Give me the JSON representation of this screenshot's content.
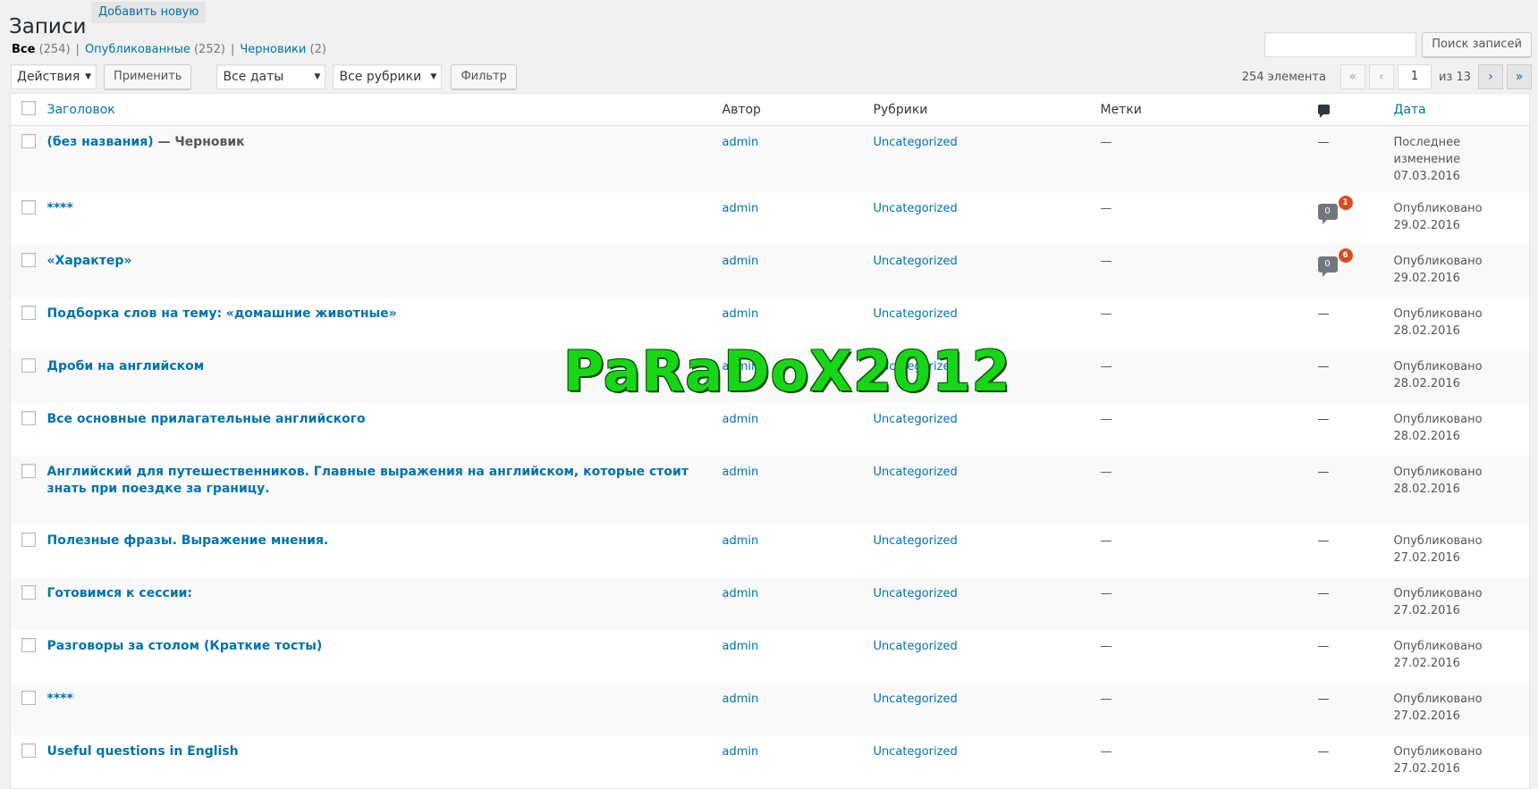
{
  "page": {
    "title": "Записи",
    "add_new": "Добавить новую"
  },
  "views": [
    {
      "label": "Все",
      "count": "(254)",
      "current": true
    },
    {
      "label": "Опубликованные",
      "count": "(252)",
      "current": false
    },
    {
      "label": "Черновики",
      "count": "(2)",
      "current": false
    }
  ],
  "search": {
    "value": "",
    "button": "Поиск записей"
  },
  "tablenav": {
    "bulk_action": "Действия",
    "apply": "Применить",
    "date_filter": "Все даты",
    "category_filter": "Все рубрики",
    "filter": "Фильтр",
    "displaying": "254 элемента",
    "first": "«",
    "prev": "‹",
    "current_page": "1",
    "of_total": "из 13",
    "next": "›",
    "last": "»"
  },
  "columns": {
    "title": "Заголовок",
    "author": "Автор",
    "categories": "Рубрики",
    "tags": "Метки",
    "date": "Дата"
  },
  "posts": [
    {
      "title": "(без названия)",
      "state": " — Черновик",
      "author": "admin",
      "category": "Uncategorized",
      "tags": "—",
      "comments": "—",
      "pending": "",
      "date_status": "Последнее изменение",
      "date": "07.03.2016"
    },
    {
      "title": "****",
      "state": "",
      "author": "admin",
      "category": "Uncategorized",
      "tags": "—",
      "comments": "0",
      "pending": "1",
      "date_status": "Опубликовано",
      "date": "29.02.2016"
    },
    {
      "title": "«Характер»",
      "state": "",
      "author": "admin",
      "category": "Uncategorized",
      "tags": "—",
      "comments": "0",
      "pending": "6",
      "date_status": "Опубликовано",
      "date": "29.02.2016"
    },
    {
      "title": "Подборка слов на тему: «домашние животные»",
      "state": "",
      "author": "admin",
      "category": "Uncategorized",
      "tags": "—",
      "comments": "—",
      "pending": "",
      "date_status": "Опубликовано",
      "date": "28.02.2016"
    },
    {
      "title": "Дроби на английском",
      "state": "",
      "author": "admin",
      "category": "Uncategorized",
      "tags": "—",
      "comments": "—",
      "pending": "",
      "date_status": "Опубликовано",
      "date": "28.02.2016"
    },
    {
      "title": "Все основные прилагательные английского",
      "state": "",
      "author": "admin",
      "category": "Uncategorized",
      "tags": "—",
      "comments": "—",
      "pending": "",
      "date_status": "Опубликовано",
      "date": "28.02.2016"
    },
    {
      "title": "Английский для путешественников. Главные выражения на английском, которые стоит знать при поездке за границу.",
      "state": "",
      "author": "admin",
      "category": "Uncategorized",
      "tags": "—",
      "comments": "—",
      "pending": "",
      "date_status": "Опубликовано",
      "date": "28.02.2016"
    },
    {
      "title": "Полезные фразы. Выражение мнения.",
      "state": "",
      "author": "admin",
      "category": "Uncategorized",
      "tags": "—",
      "comments": "—",
      "pending": "",
      "date_status": "Опубликовано",
      "date": "27.02.2016"
    },
    {
      "title": "Готовимся к сессии:",
      "state": "",
      "author": "admin",
      "category": "Uncategorized",
      "tags": "—",
      "comments": "—",
      "pending": "",
      "date_status": "Опубликовано",
      "date": "27.02.2016"
    },
    {
      "title": "Разговоры за столом (Краткие тосты)",
      "state": "",
      "author": "admin",
      "category": "Uncategorized",
      "tags": "—",
      "comments": "—",
      "pending": "",
      "date_status": "Опубликовано",
      "date": "27.02.2016"
    },
    {
      "title": "****",
      "state": "",
      "author": "admin",
      "category": "Uncategorized",
      "tags": "—",
      "comments": "—",
      "pending": "",
      "date_status": "Опубликовано",
      "date": "27.02.2016"
    },
    {
      "title": "Useful questions in English",
      "state": "",
      "author": "admin",
      "category": "Uncategorized",
      "tags": "—",
      "comments": "—",
      "pending": "",
      "date_status": "Опубликовано",
      "date": "27.02.2016"
    }
  ],
  "watermark": "PaRaDoX2012"
}
